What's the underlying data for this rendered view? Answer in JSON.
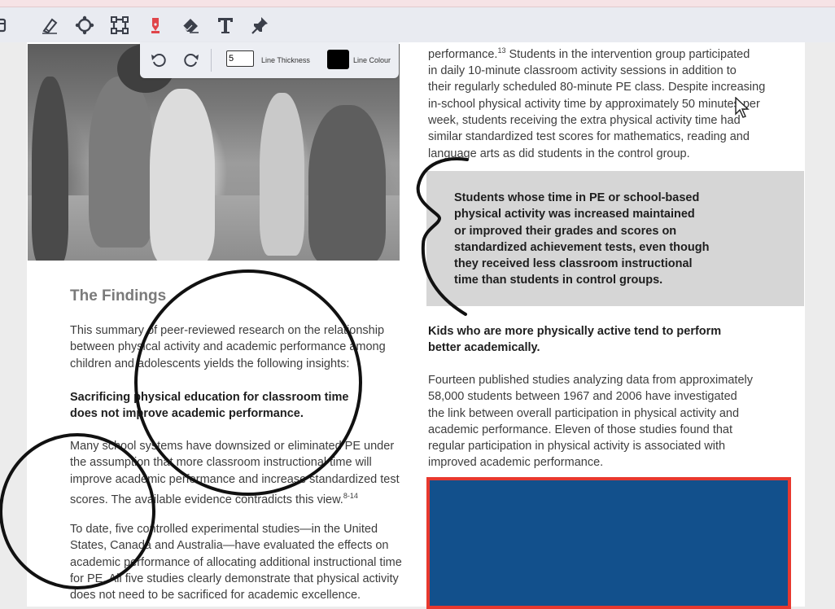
{
  "toolbar": {
    "tools": [
      "panel-icon",
      "highlighter-icon",
      "lasso-icon",
      "select-box-icon",
      "pen-icon",
      "eraser-icon",
      "text-icon",
      "pin-icon"
    ],
    "active_tool_color": "#e0454a"
  },
  "subtoolbar": {
    "line_thickness_value": "5",
    "line_thickness_label": "Line Thickness",
    "line_colour_label": "Line Colour",
    "line_colour": "#000000"
  },
  "document": {
    "right_top": {
      "line1a": "performance.",
      "line1sup": "13",
      "line1b": " Students in the intervention group participated",
      "line2": "in daily 10-minute classroom activity sessions in addition to",
      "line3": "their regularly scheduled 80-minute PE class. Despite increasing",
      "line4": "in-school physical activity time by approximately 50 minutes per",
      "line5": "week, students receiving the extra physical activity time had",
      "line6": "similar standardized test scores for mathematics, reading and",
      "line7": "language arts as did students in the control group."
    },
    "callout": {
      "line1": "Students whose time in PE or school-based",
      "line2": "physical activity was increased maintained",
      "line3": "or improved their grades and scores on",
      "line4": "standardized achievement tests, even though",
      "line5": "they received less classroom instructional",
      "line6": "time than students in control groups."
    },
    "kids_heading": {
      "line1": "Kids who are more physically active tend to perform",
      "line2": "better academically."
    },
    "fourteen": {
      "line1": "Fourteen published studies analyzing data from approximately",
      "line2": "58,000 students between 1967 and 2006 have investigated",
      "line3": "the link between overall participation in physical activity and",
      "line4": "academic performance. Eleven of those studies found that",
      "line5": "regular participation in physical activity is associated with",
      "line6": "improved academic performance."
    },
    "findings_title": "The Findings",
    "summary": {
      "line1": "This summary of peer-reviewed research on the relationship",
      "line2": "between physical activity and academic performance among",
      "line3": "children and adolescents yields the following insights:"
    },
    "sacrificing": {
      "line1": "Sacrificing physical education for classroom time",
      "line2": "does not improve academic performance."
    },
    "many": {
      "line1": "Many school systems have downsized or eliminated PE under",
      "line2": "the assumption that more classroom instructional time will",
      "line3": "improve academic performance and increase standardized test",
      "line4a": "scores. The available evidence contradicts this view.",
      "line4sup": "8-14"
    },
    "todate": {
      "line1": "To date, five controlled experimental studies—in the United",
      "line2": "States, Canada and Australia—have evaluated the effects on",
      "line3": "academic performance of allocating additional instructional time",
      "line4": "for PE. All five studies clearly demonstrate that physical activity",
      "line5": "does not need to be sacrificed for academic excellence."
    }
  },
  "colors": {
    "callout_bg": "#d6d6d6",
    "bluebox_fill": "#12508c",
    "bluebox_border": "#e8382e",
    "ink": "#111111"
  }
}
